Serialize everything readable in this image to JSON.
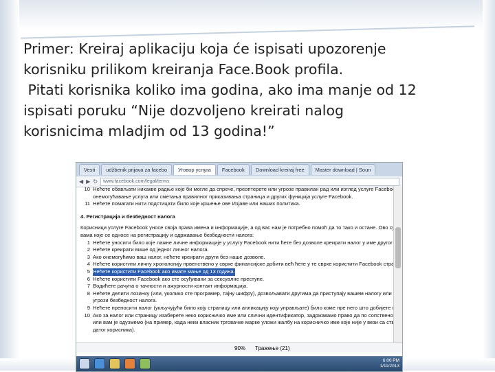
{
  "slide": {
    "lines": [
      "Primer: Kreiraj aplikaciju koja će ispisati upozorenje",
      "korisniku prilikom kreiranja Face.Book profila.",
      " Pitati korisnika koliko ima godina, ako ima manje od 12",
      "ispisati poruku “Nije dozvoljeno kreirati nalog",
      "korisnicima mladjim od 13 godina!”"
    ]
  },
  "browser": {
    "tabs": [
      {
        "label": "Vesti"
      },
      {
        "label": "udžbenik prijava za facebo"
      },
      {
        "label": "Уговор услуга"
      },
      {
        "label": "Facebook"
      },
      {
        "label": "Download kreiraj free"
      },
      {
        "label": "Master download | Soun"
      }
    ],
    "address": "www.facebook.com/legal/terms",
    "content": {
      "top_items": [
        {
          "num": "10",
          "text": "Нећете обављати никакве радње које би могле да спрече, преоптерете или угрозе правилан рад или изглед услуге Facebook,"
        },
        {
          "num": "",
          "text": "онемогућавање услуга или сметања правилног приказивања страница и других функција услуге Facebook."
        },
        {
          "num": "11",
          "text": "Нећете помагати нити подстицати било које кршење ове Изјаве или наших политика."
        }
      ],
      "section_title": "4. Регистрација и безбедност налога",
      "intro_1": "Корисници услуге Facebook уносе своја права имена и информације, а од вас нам је потребно помоћ да то тако и остане. Ово су неке од обавеза",
      "intro_2": "вама које се односе на регистрацију и одржавање безбедности налога:",
      "items": [
        {
          "num": "1",
          "text": "Нећете уносити било које лажне личне информације у услугу Facebook нити ћете без дозволе креирати налог у име другог лица.",
          "highlight": false
        },
        {
          "num": "2",
          "text": "Нећете креирати више од једног личног налога.",
          "highlight": false
        },
        {
          "num": "3",
          "text": "Ако онемогућимо ваш налог, нећете креирати други без наше дозволе.",
          "highlight": false
        },
        {
          "num": "4",
          "text": "Нећете користити личну хронологију првенствено у сврхе финансијске добити већ ћете у те сврхе користити Facebook страницу.",
          "highlight": false
        },
        {
          "num": "5",
          "text": "Нећете користити Facebook ако имате мање од 13 година.",
          "highlight": true
        },
        {
          "num": "6",
          "text": "Нећете користити Facebook ако сте осуђивани за сексуалне преступе.",
          "highlight": false
        },
        {
          "num": "7",
          "text": "Водићете рачуна о тачности и ажурности контакт информација.",
          "highlight": false
        },
        {
          "num": "8",
          "text": "Нећете делити лозинку (или, уколико сте програмер, тајну шифру), дозвољавати другима да приступају вашем налогу или чинити било шта што би могло да",
          "highlight": false
        },
        {
          "num": "",
          "text": "угрози безбедност налога.",
          "highlight": false
        },
        {
          "num": "9",
          "text": "Нећете преносити налог (укључујући било коју страницу или апликацију коју управљате) било коме пре него што добијете нашу писмену дозволу.",
          "highlight": false
        },
        {
          "num": "10",
          "text": "Ако за налог или страницу изаберете неко корисничко име или слични идентификатор, задржавамо право да по сопственом нахођењу",
          "highlight": false
        },
        {
          "num": "",
          "text": "или вам је одузмемо (на пример, када неки власник трговачке марке уложи жалбу на корисничко име које није у вези са стварним именом",
          "highlight": false
        },
        {
          "num": "",
          "text": "датог корисника).",
          "highlight": false
        }
      ]
    },
    "findbar": {
      "zoom": "90%",
      "status": "Тражење (21)"
    },
    "clock": {
      "time": "6:00 PM",
      "date": "1/11/2013"
    }
  }
}
